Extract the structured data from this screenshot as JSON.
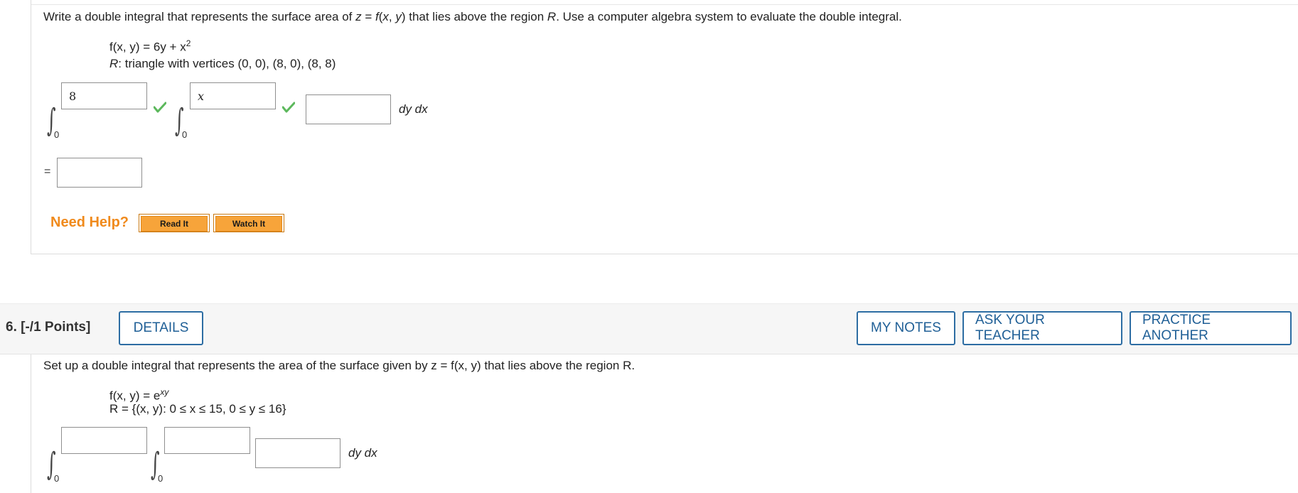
{
  "q5": {
    "prompt_parts": [
      "Write a double integral that represents the surface area of ",
      "z",
      " = ",
      "f",
      "(",
      "x",
      ", ",
      "y",
      ") that lies above the region ",
      "R",
      ". Use a computer algebra system to evaluate the double integral."
    ],
    "function_label": "f(x, y) = 6y + x",
    "function_exp": "2",
    "region_label_prefix": "R",
    "region_label": ": triangle with vertices (0, 0), (8, 0), (8, 8)",
    "outer_integral": {
      "lower": "0",
      "upper_value": "8",
      "upper_correct": true
    },
    "inner_integral": {
      "lower": "0",
      "upper_value": "x",
      "upper_correct": true
    },
    "integrand_value": "",
    "differentials": "dy dx",
    "equals": "=",
    "result_value": "",
    "need_help": "Need Help?",
    "read_it": "Read It",
    "watch_it": "Watch It"
  },
  "q6": {
    "number": "6.",
    "points": "[-/1 Points]",
    "details_label": "DETAILS",
    "my_notes_label": "MY NOTES",
    "ask_teacher_label": "ASK YOUR TEACHER",
    "practice_label": "PRACTICE ANOTHER",
    "prompt": "Set up a double integral that represents the area of the surface given by z = f(x, y) that lies above the region R.",
    "function_label": "f(x, y) = e",
    "function_exp": "xy",
    "region_label": "R = {(x, y): 0 ≤ x ≤ 15, 0 ≤ y ≤ 16}",
    "outer_integral": {
      "lower": "0",
      "upper_value": ""
    },
    "inner_integral": {
      "lower": "0",
      "upper_value": ""
    },
    "integrand_value": "",
    "differentials": "dy dx"
  },
  "colors": {
    "accent_orange": "#f08a1c",
    "button_blue": "#2d6da3",
    "check_green": "#5cb85c"
  }
}
